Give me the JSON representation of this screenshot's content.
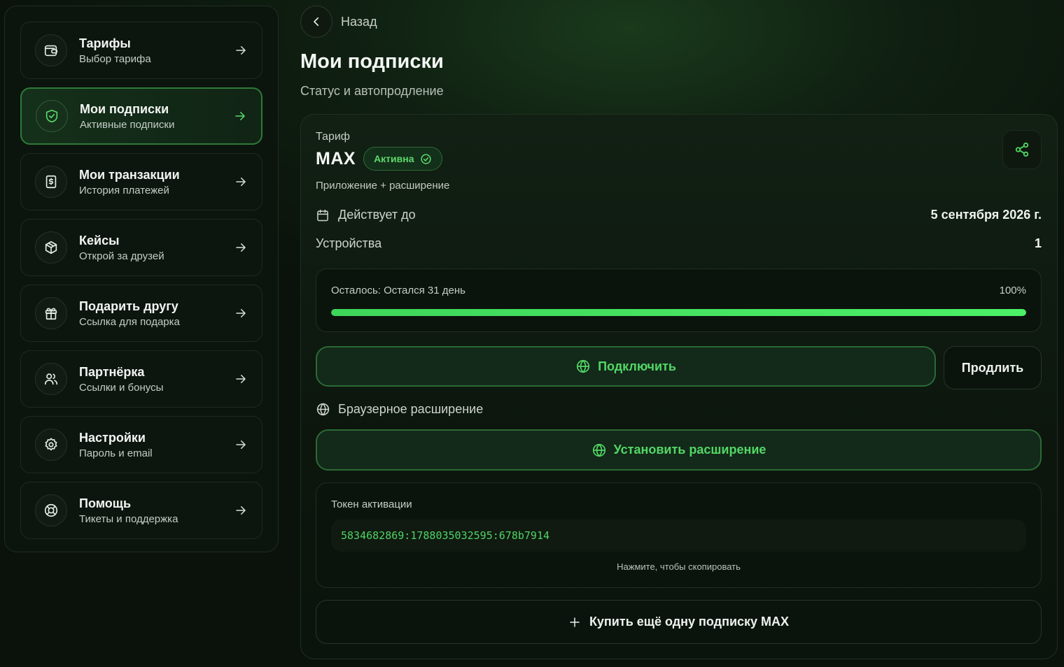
{
  "sidebar": {
    "items": [
      {
        "title": "Тарифы",
        "subtitle": "Выбор тарифа",
        "icon": "wallet-icon",
        "active": false
      },
      {
        "title": "Мои подписки",
        "subtitle": "Активные подписки",
        "icon": "shield-check-icon",
        "active": true
      },
      {
        "title": "Мои транзакции",
        "subtitle": "История платежей",
        "icon": "receipt-dollar-icon",
        "active": false
      },
      {
        "title": "Кейсы",
        "subtitle": "Открой за друзей",
        "icon": "box-icon",
        "active": false
      },
      {
        "title": "Подарить другу",
        "subtitle": "Ссылка для подарка",
        "icon": "gift-icon",
        "active": false
      },
      {
        "title": "Партнёрка",
        "subtitle": "Ссылки и бонусы",
        "icon": "users-icon",
        "active": false
      },
      {
        "title": "Настройки",
        "subtitle": "Пароль и email",
        "icon": "gear-icon",
        "active": false
      },
      {
        "title": "Помощь",
        "subtitle": "Тикеты и поддержка",
        "icon": "lifebuoy-icon",
        "active": false
      }
    ]
  },
  "header": {
    "back_label": "Назад",
    "title": "Мои подписки",
    "subtitle": "Статус и автопродление"
  },
  "subscription": {
    "tariff_label": "Тариф",
    "plan_name": "MAX",
    "status_badge": "Активна",
    "description": "Приложение + расширение",
    "valid_until_label": "Действует до",
    "valid_until_value": "5 сентября 2026 г.",
    "devices_label": "Устройства",
    "devices_value": "1",
    "progress_label": "Осталось: Остался 31 день",
    "progress_percent_label": "100%",
    "progress_value": 1.0,
    "connect_label": "Подключить",
    "extend_label": "Продлить",
    "extension_label": "Браузерное расширение",
    "install_label": "Установить расширение",
    "token_label": "Токен активации",
    "token_value": "5834682869:1788035032595:678b7914",
    "token_hint": "Нажмите, чтобы скопировать",
    "buy_more_label": "Купить ещё одну подписку MAX"
  },
  "colors": {
    "accent": "#4cf068",
    "accent_text": "#52d865",
    "background": "#0b130c",
    "active_border": "#2e7a3a"
  }
}
